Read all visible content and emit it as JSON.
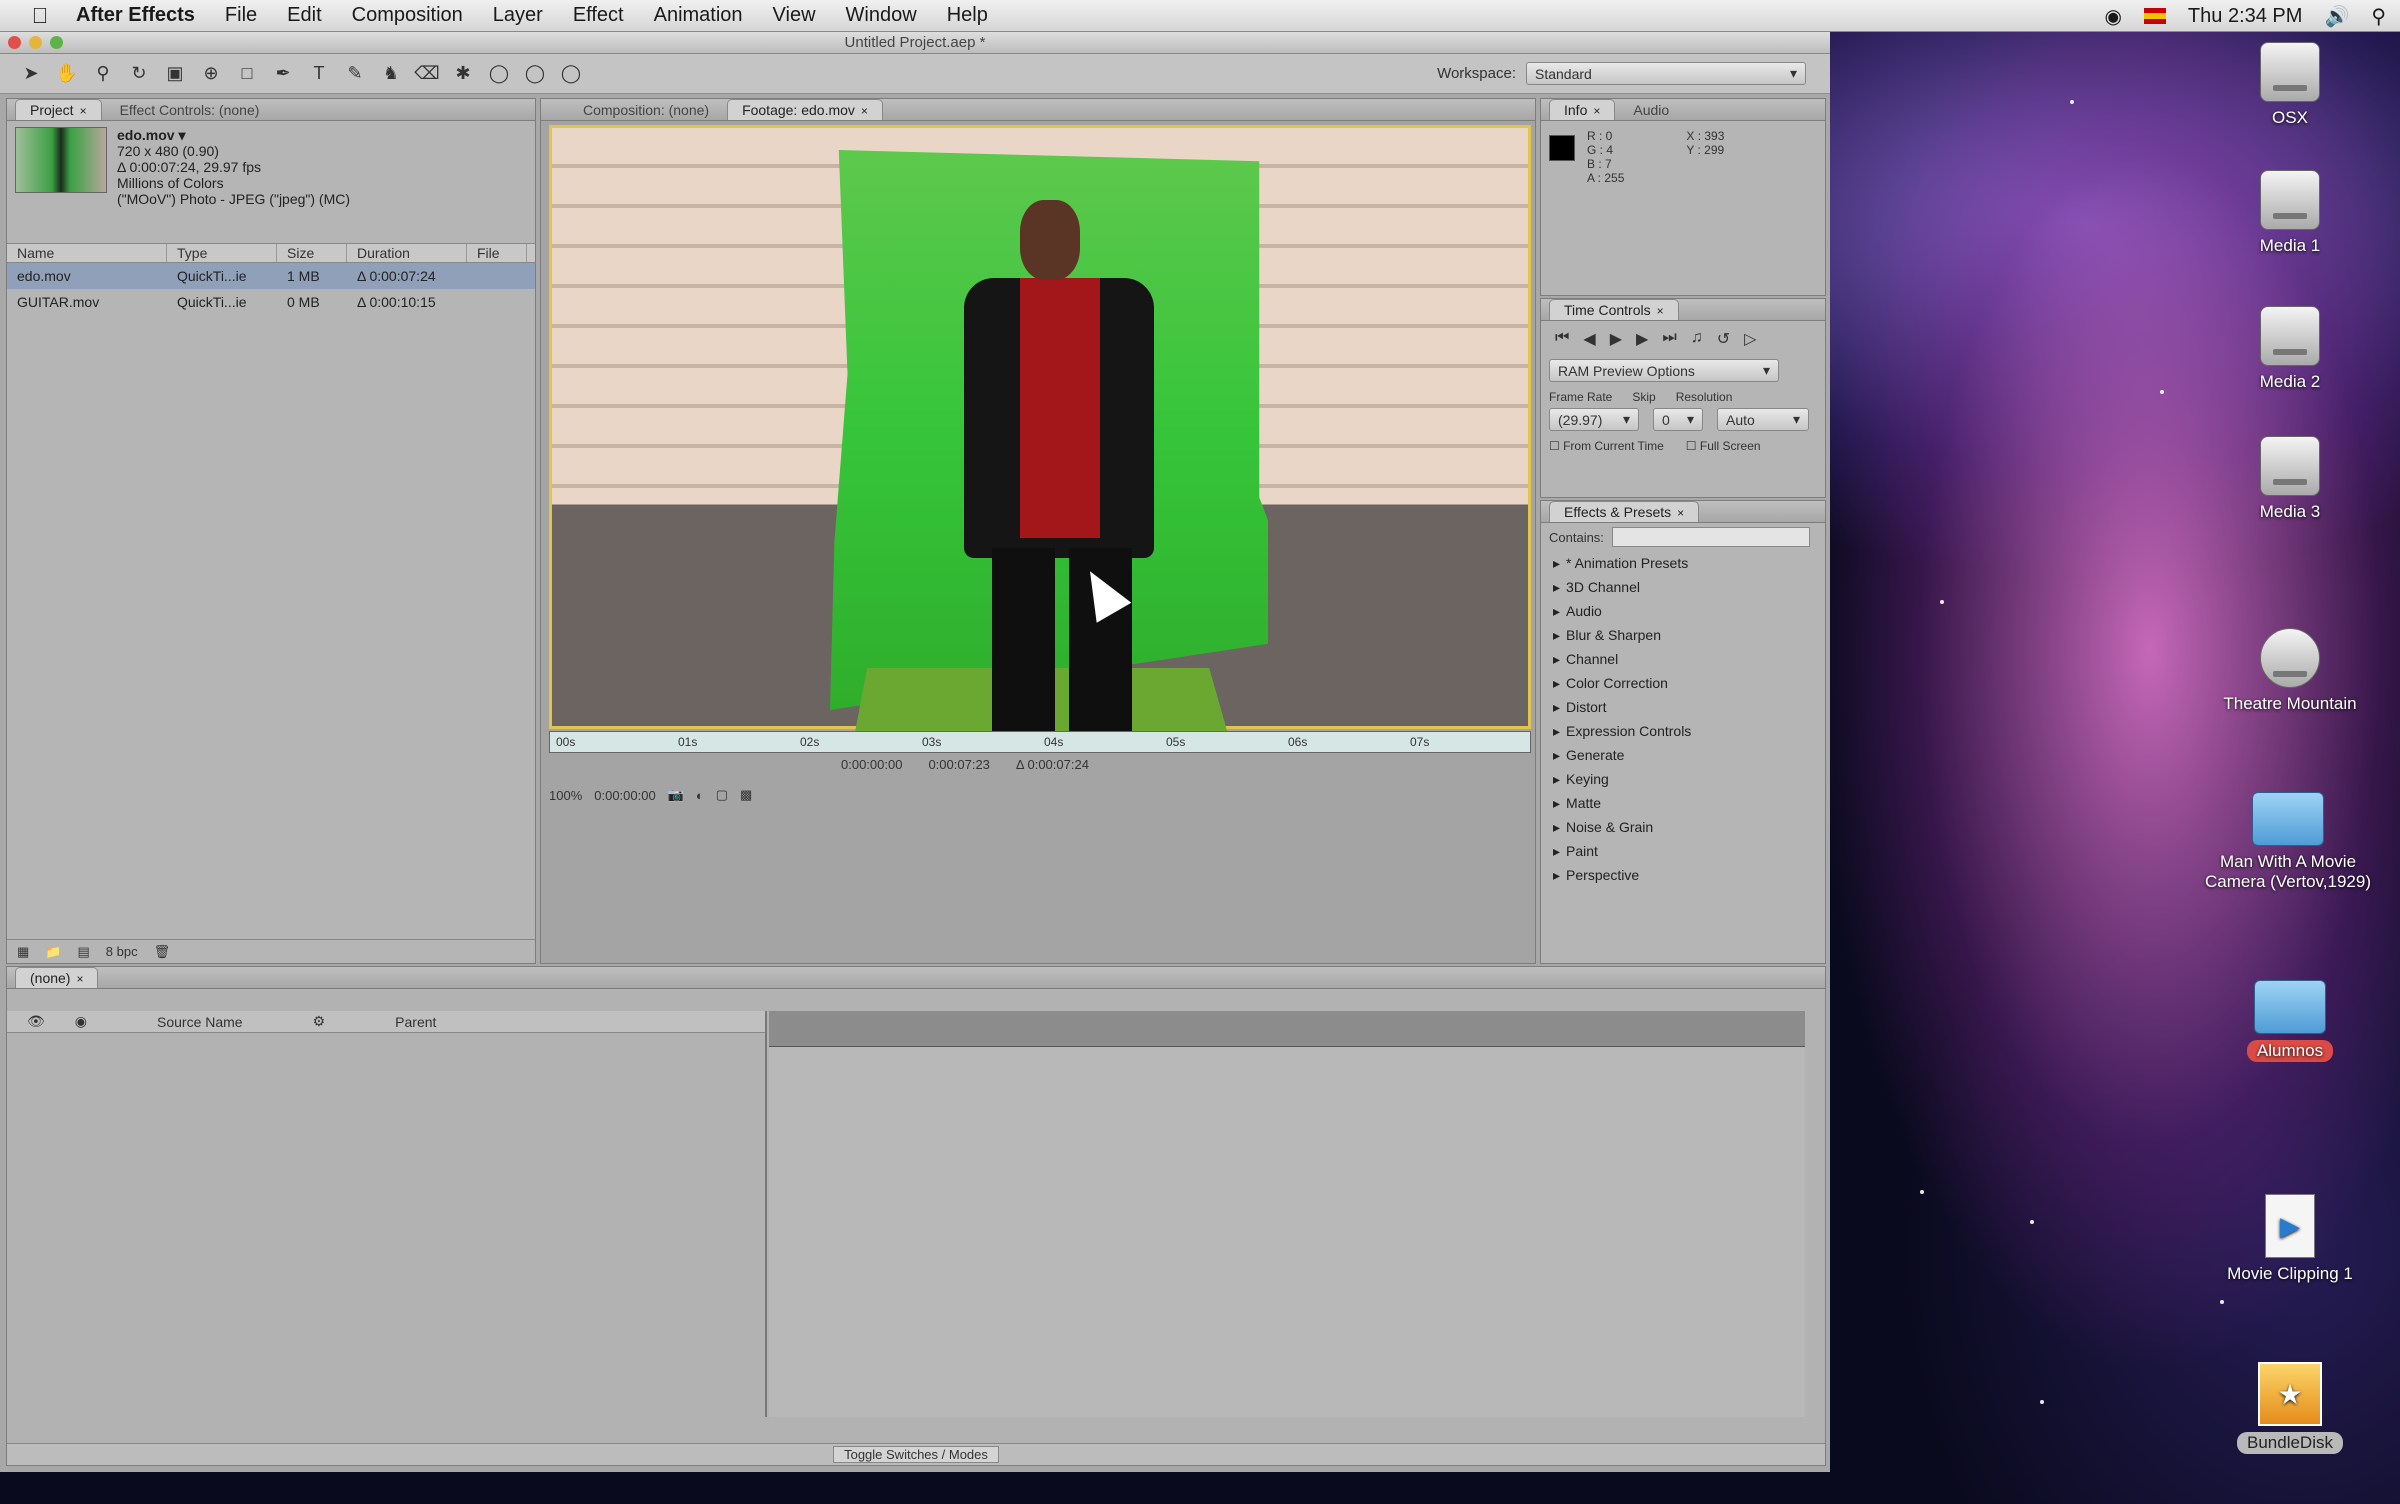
{
  "menubar": {
    "app_name": "After Effects",
    "items": [
      "File",
      "Edit",
      "Composition",
      "Layer",
      "Effect",
      "Animation",
      "View",
      "Window",
      "Help"
    ],
    "clock": "Thu 2:34 PM"
  },
  "window": {
    "title": "Untitled Project.aep *",
    "workspace_label": "Workspace:",
    "workspace_value": "Standard"
  },
  "project_panel": {
    "tabs": [
      "Project",
      "Effect Controls: (none)"
    ],
    "file_name": "edo.mov ▾",
    "file_info": [
      "720 x 480 (0.90)",
      "Δ 0:00:07:24, 29.97 fps",
      "Millions of Colors",
      "(\"MOoV\") Photo - JPEG (\"jpeg\") (MC)"
    ],
    "columns": [
      "Name",
      "Type",
      "Size",
      "Duration",
      "File"
    ],
    "rows": [
      {
        "name": "edo.mov",
        "type": "QuickTi...ie",
        "size": "1 MB",
        "duration": "Δ 0:00:07:24"
      },
      {
        "name": "GUITAR.mov",
        "type": "QuickTi...ie",
        "size": "0 MB",
        "duration": "Δ 0:00:10:15"
      }
    ],
    "footer_text": "8 bpc"
  },
  "comp_panel": {
    "tabs": [
      "Composition: (none)",
      "Footage: edo.mov"
    ],
    "ruler_labels": [
      "00s",
      "01s",
      "02s",
      "03s",
      "04s",
      "05s",
      "06s",
      "07s"
    ],
    "time_in": "0:00:00:00",
    "time_out": "0:00:07:23",
    "time_duration": "Δ 0:00:07:24",
    "zoom": "100%",
    "current_time": "0:00:00:00"
  },
  "info_panel": {
    "tabs": [
      "Info",
      "Audio"
    ],
    "r": "R : 0",
    "g": "G : 4",
    "b": "B : 7",
    "a": "A : 255",
    "x": "X : 393",
    "y": "Y : 299"
  },
  "time_controls": {
    "tab": "Time Controls",
    "ram_preview": "RAM Preview Options",
    "labels": [
      "Frame Rate",
      "Skip",
      "Resolution"
    ],
    "frame_rate": "(29.97)",
    "skip": "0",
    "resolution": "Auto",
    "from_current": "From Current Time",
    "full_screen": "Full Screen"
  },
  "effects_panel": {
    "tab": "Effects & Presets",
    "contains_label": "Contains:",
    "items": [
      "* Animation Presets",
      "3D Channel",
      "Audio",
      "Blur & Sharpen",
      "Channel",
      "Color Correction",
      "Distort",
      "Expression Controls",
      "Generate",
      "Keying",
      "Matte",
      "Noise & Grain",
      "Paint",
      "Perspective"
    ]
  },
  "timeline": {
    "tab": "(none)",
    "source_name": "Source Name",
    "parent": "Parent",
    "toggle": "Toggle Switches / Modes"
  },
  "desktop_icons": [
    {
      "label": "OSX",
      "kind": "disk"
    },
    {
      "label": "Media 1",
      "kind": "disk"
    },
    {
      "label": "Media 2",
      "kind": "disk"
    },
    {
      "label": "Media 3",
      "kind": "disk"
    },
    {
      "label": "Theatre Mountain",
      "kind": "disk"
    },
    {
      "label": "Man With A Movie Camera (Vertov,1929)",
      "kind": "folder"
    },
    {
      "label": "Alumnos",
      "kind": "folder"
    },
    {
      "label": "Movie Clipping 1",
      "kind": "doc"
    },
    {
      "label": "BundleDisk",
      "kind": "pkg"
    }
  ]
}
